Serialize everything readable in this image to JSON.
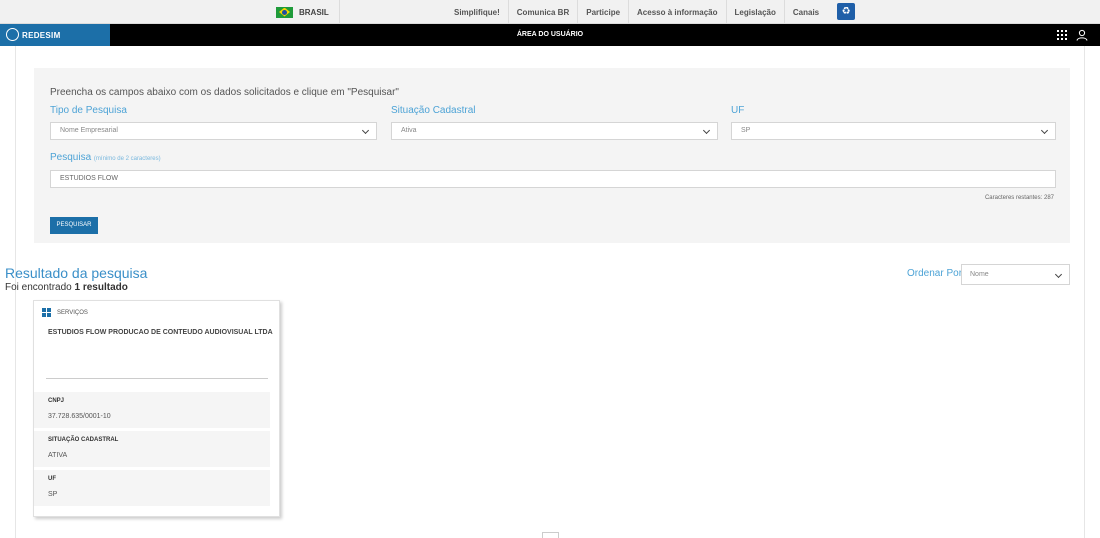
{
  "govbar": {
    "brasil": "BRASIL",
    "links": [
      "Simplifique!",
      "Comunica BR",
      "Participe",
      "Acesso à informação",
      "Legislação",
      "Canais"
    ]
  },
  "header": {
    "logo": "REDESIM",
    "title": "ÁREA DO USUÁRIO"
  },
  "search": {
    "instructions": "Preencha os campos abaixo com os dados solicitados e clique em \"Pesquisar\"",
    "tipo_label": "Tipo de Pesquisa",
    "tipo_value": "Nome Empresarial",
    "situacao_label": "Situação Cadastral",
    "situacao_value": "Ativa",
    "uf_label": "UF",
    "uf_value": "SP",
    "pesquisa_label": "Pesquisa",
    "pesquisa_hint": "(mínimo de 2 caracteres)",
    "pesquisa_value": "ESTUDIOS FLOW",
    "counter": "Caracteres restantes: 287",
    "button": "PESQUISAR"
  },
  "results": {
    "title": "Resultado da pesquisa",
    "found_prefix": "Foi encontrado ",
    "found_count": "1 resultado",
    "order_label": "Ordenar Por",
    "order_value": "Nome",
    "card": {
      "category": "SERVIÇOS",
      "name": "ESTUDIOS FLOW PRODUCAO DE CONTEUDO AUDIOVISUAL LTDA",
      "fields": [
        {
          "label": "CNPJ",
          "value": "37.728.635/0001-10"
        },
        {
          "label": "SITUAÇÃO CADASTRAL",
          "value": "ATIVA"
        },
        {
          "label": "UF",
          "value": "SP"
        }
      ]
    }
  }
}
